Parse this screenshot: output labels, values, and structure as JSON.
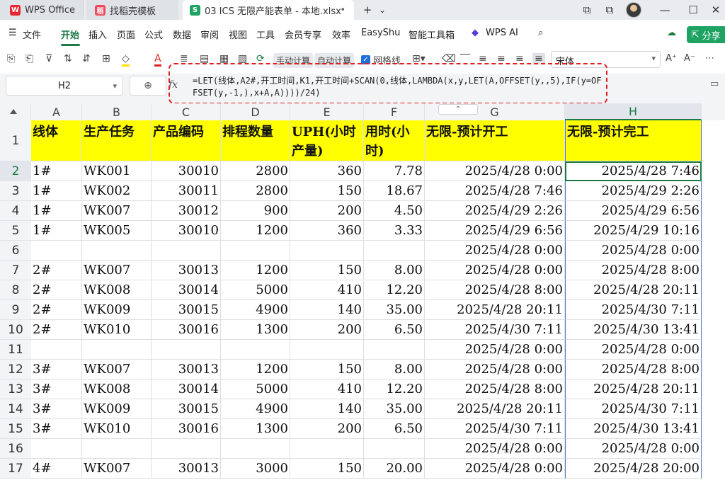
{
  "titlebar": {
    "tabs": [
      {
        "label": "WPS Office",
        "icon": "W"
      },
      {
        "label": "找稻壳模板",
        "icon": "稻"
      },
      {
        "label": "03 ICS 无限产能表单 - 本地.xlsx",
        "icon": "S"
      }
    ],
    "close_tab": "•",
    "new_tab": "+",
    "tab_menu": "⌄",
    "window_controls": [
      "⧉",
      "—",
      "☐",
      "✕"
    ]
  },
  "menubar": {
    "items": [
      "文件",
      "开始",
      "插入",
      "页面",
      "公式",
      "数据",
      "审阅",
      "视图",
      "工具",
      "会员专享",
      "效率",
      "EasyShu",
      "智能工具箱",
      "WPS AI"
    ],
    "share": "分享",
    "hamburger": "☰"
  },
  "toolbar": {
    "calc_manual": "手动计算",
    "calc_auto": "自动计算",
    "gridlines": "网格线",
    "font": "宋体",
    "font_grow": "A⁺",
    "font_shrink": "A⁻",
    "more": "⋯"
  },
  "formulabar": {
    "name_box": "H2",
    "fx": "fx",
    "formula": "=LET(线体,A2#,开工时间,K1,开工时间+SCAN(0,线体,LAMBDA(x,y,LET(A,OFFSET(y,,5),IF(y=OFFSET(y,-1,),x+A,A))))/24)"
  },
  "columns": [
    "A",
    "B",
    "C",
    "D",
    "E",
    "F",
    "G",
    "H"
  ],
  "collapse_button": "⌃",
  "header_row": {
    "row": "1",
    "cells": [
      "线体",
      "生产任务",
      "产品编码",
      "排程数量",
      "UPH(小时产量)",
      "用时(小时)",
      "无限-预计开工",
      "无限-预计完工"
    ]
  },
  "rows": [
    {
      "row": "2",
      "cells": [
        "1#",
        "WK001",
        "30010",
        "2800",
        "360",
        "7.78",
        "2025/4/28 0:00",
        "2025/4/28 7:46"
      ]
    },
    {
      "row": "3",
      "cells": [
        "1#",
        "WK002",
        "30011",
        "2800",
        "150",
        "18.67",
        "2025/4/28 7:46",
        "2025/4/29 2:26"
      ]
    },
    {
      "row": "4",
      "cells": [
        "1#",
        "WK007",
        "30012",
        "900",
        "200",
        "4.50",
        "2025/4/29 2:26",
        "2025/4/29 6:56"
      ]
    },
    {
      "row": "5",
      "cells": [
        "1#",
        "WK005",
        "30010",
        "1200",
        "360",
        "3.33",
        "2025/4/29 6:56",
        "2025/4/29 10:16"
      ]
    },
    {
      "row": "6",
      "cells": [
        "",
        "",
        "",
        "",
        "",
        "",
        "2025/4/28 0:00",
        "2025/4/28 0:00"
      ]
    },
    {
      "row": "7",
      "cells": [
        "2#",
        "WK007",
        "30013",
        "1200",
        "150",
        "8.00",
        "2025/4/28 0:00",
        "2025/4/28 8:00"
      ]
    },
    {
      "row": "8",
      "cells": [
        "2#",
        "WK008",
        "30014",
        "5000",
        "410",
        "12.20",
        "2025/4/28 8:00",
        "2025/4/28 20:11"
      ]
    },
    {
      "row": "9",
      "cells": [
        "2#",
        "WK009",
        "30015",
        "4900",
        "140",
        "35.00",
        "2025/4/28 20:11",
        "2025/4/30 7:11"
      ]
    },
    {
      "row": "10",
      "cells": [
        "2#",
        "WK010",
        "30016",
        "1300",
        "200",
        "6.50",
        "2025/4/30 7:11",
        "2025/4/30 13:41"
      ]
    },
    {
      "row": "11",
      "cells": [
        "",
        "",
        "",
        "",
        "",
        "",
        "2025/4/28 0:00",
        "2025/4/28 0:00"
      ]
    },
    {
      "row": "12",
      "cells": [
        "3#",
        "WK007",
        "30013",
        "1200",
        "150",
        "8.00",
        "2025/4/28 0:00",
        "2025/4/28 8:00"
      ]
    },
    {
      "row": "13",
      "cells": [
        "3#",
        "WK008",
        "30014",
        "5000",
        "410",
        "12.20",
        "2025/4/28 8:00",
        "2025/4/28 20:11"
      ]
    },
    {
      "row": "14",
      "cells": [
        "3#",
        "WK009",
        "30015",
        "4900",
        "140",
        "35.00",
        "2025/4/28 20:11",
        "2025/4/30 7:11"
      ]
    },
    {
      "row": "15",
      "cells": [
        "3#",
        "WK010",
        "30016",
        "1300",
        "200",
        "6.50",
        "2025/4/30 7:11",
        "2025/4/30 13:41"
      ]
    },
    {
      "row": "16",
      "cells": [
        "",
        "",
        "",
        "",
        "",
        "",
        "2025/4/28 0:00",
        "2025/4/28 0:00"
      ]
    },
    {
      "row": "17",
      "cells": [
        "4#",
        "WK007",
        "30013",
        "3000",
        "150",
        "20.00",
        "2025/4/28 0:00",
        "2025/4/28 20:00"
      ]
    }
  ],
  "colors": {
    "header_fill": "#ffff00",
    "accent": "#1d7a45",
    "highlight": "#e02020"
  }
}
